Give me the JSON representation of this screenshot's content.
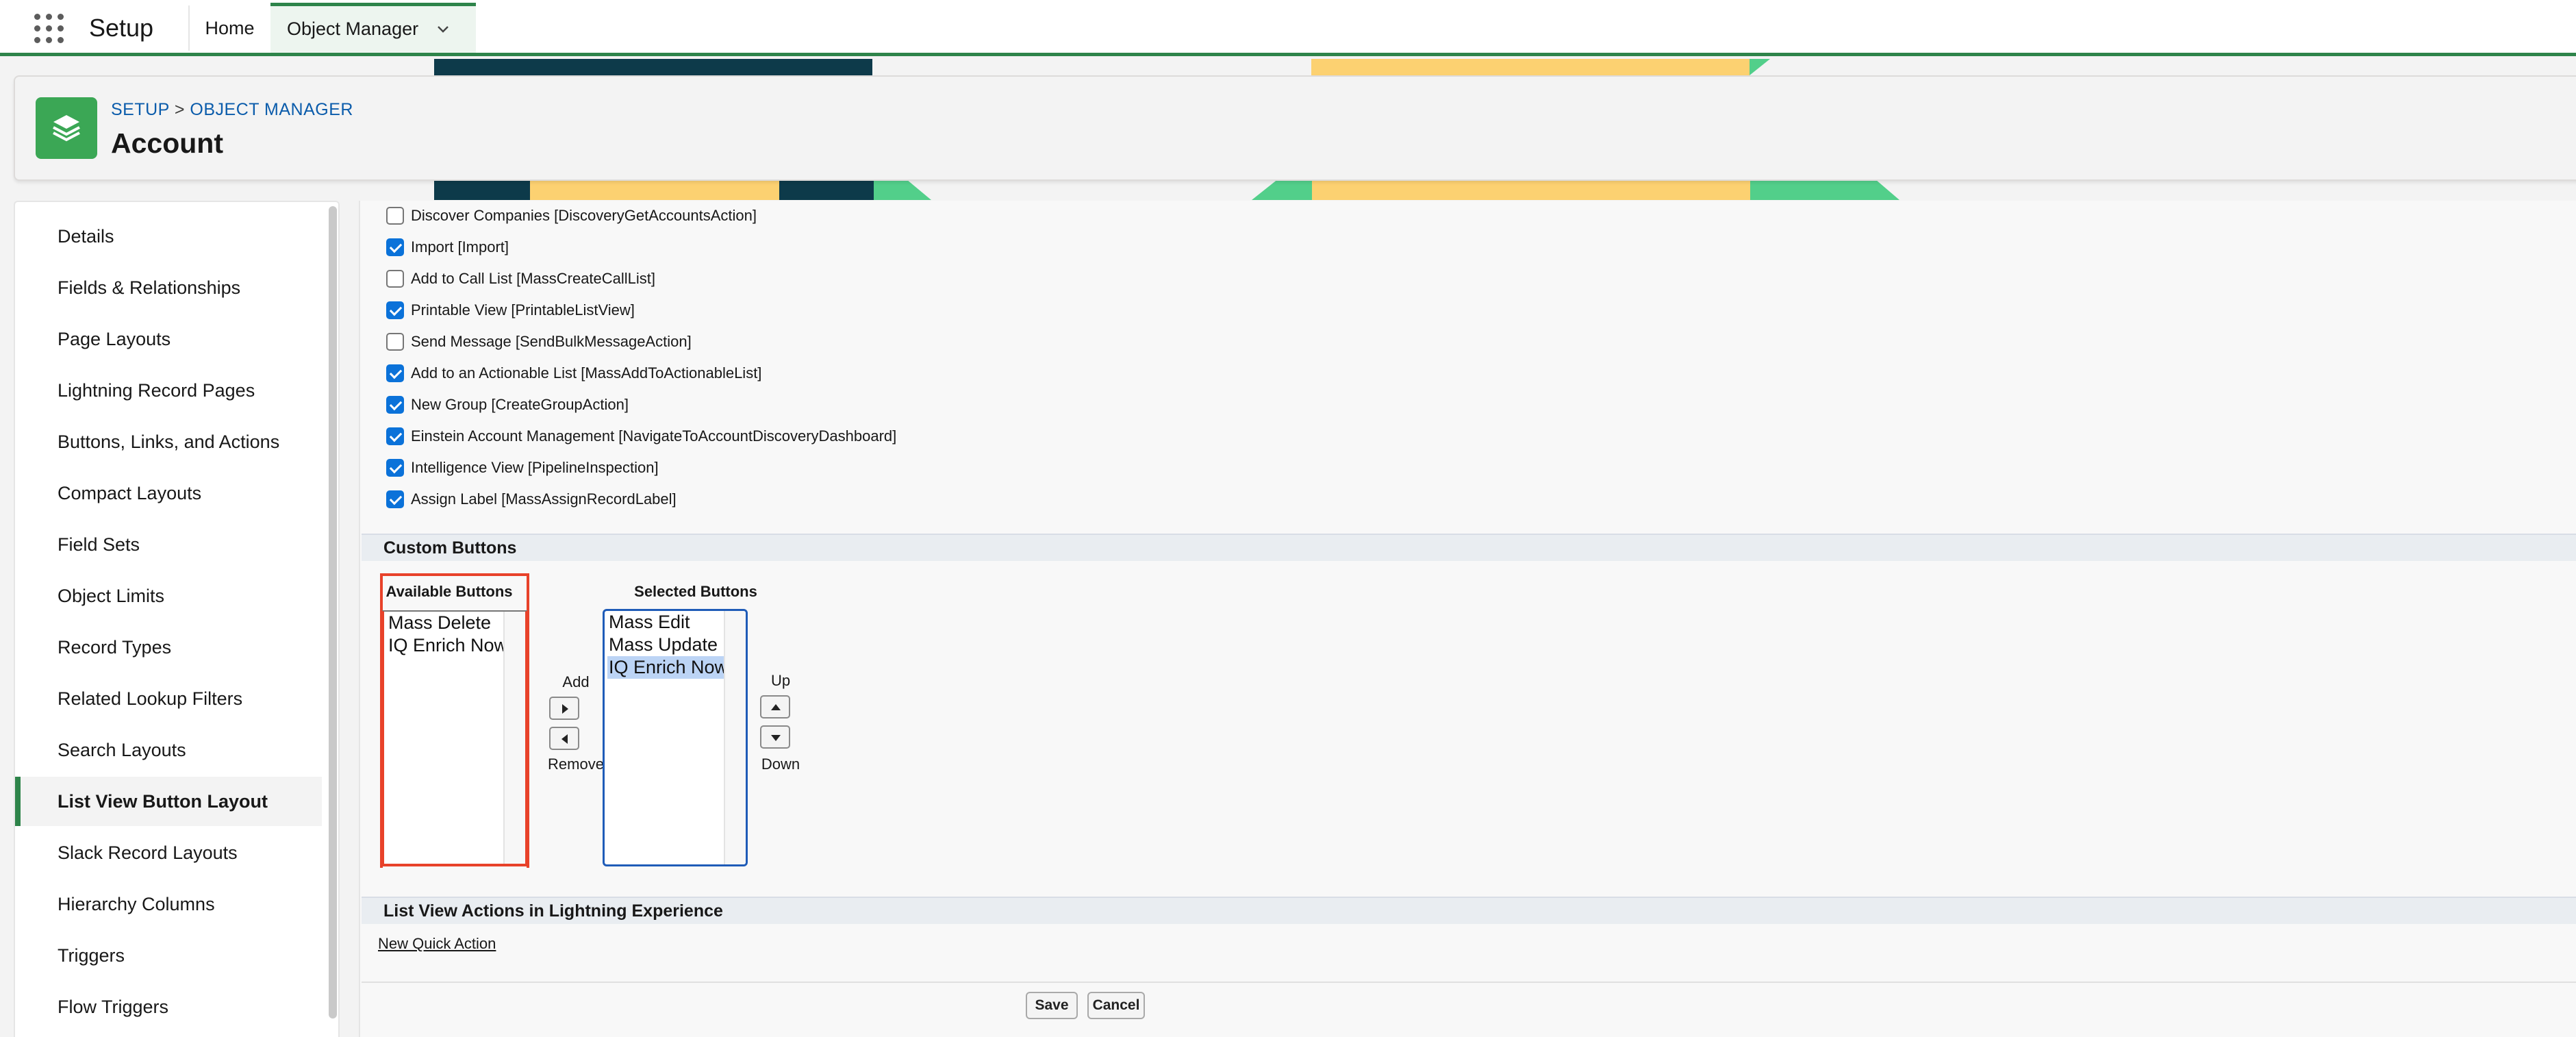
{
  "nav": {
    "app_name": "Setup",
    "tabs": [
      {
        "label": "Home"
      },
      {
        "label": "Object Manager"
      }
    ]
  },
  "header": {
    "breadcrumb_setup": "SETUP",
    "breadcrumb_sep": ">",
    "breadcrumb_object_manager": "OBJECT MANAGER",
    "title": "Account"
  },
  "sidebar": {
    "items": [
      {
        "label": "Details"
      },
      {
        "label": "Fields & Relationships"
      },
      {
        "label": "Page Layouts"
      },
      {
        "label": "Lightning Record Pages"
      },
      {
        "label": "Buttons, Links, and Actions"
      },
      {
        "label": "Compact Layouts"
      },
      {
        "label": "Field Sets"
      },
      {
        "label": "Object Limits"
      },
      {
        "label": "Record Types"
      },
      {
        "label": "Related Lookup Filters"
      },
      {
        "label": "Search Layouts"
      },
      {
        "label": "List View Button Layout"
      },
      {
        "label": "Slack Record Layouts"
      },
      {
        "label": "Hierarchy Columns"
      },
      {
        "label": "Triggers"
      },
      {
        "label": "Flow Triggers"
      }
    ],
    "active_index": 11
  },
  "standard_buttons": [
    {
      "label": "Discover Companies [DiscoveryGetAccountsAction]",
      "checked": false
    },
    {
      "label": "Import [Import]",
      "checked": true
    },
    {
      "label": "Add to Call List [MassCreateCallList]",
      "checked": false
    },
    {
      "label": "Printable View [PrintableListView]",
      "checked": true
    },
    {
      "label": "Send Message [SendBulkMessageAction]",
      "checked": false
    },
    {
      "label": "Add to an Actionable List [MassAddToActionableList]",
      "checked": true
    },
    {
      "label": "New Group [CreateGroupAction]",
      "checked": true
    },
    {
      "label": "Einstein Account Management [NavigateToAccountDiscoveryDashboard]",
      "checked": true
    },
    {
      "label": "Intelligence View [PipelineInspection]",
      "checked": true
    },
    {
      "label": "Assign Label [MassAssignRecordLabel]",
      "checked": true
    }
  ],
  "custom_buttons": {
    "section_title": "Custom Buttons",
    "available_label": "Available Buttons",
    "available": [
      "Mass Delete",
      "IQ Enrich Now"
    ],
    "selected_label": "Selected Buttons",
    "selected": [
      "Mass Edit",
      "Mass Update",
      "IQ Enrich Now"
    ],
    "selected_highlight_index": 2,
    "add_label": "Add",
    "remove_label": "Remove",
    "up_label": "Up",
    "down_label": "Down"
  },
  "lightning_actions": {
    "section_title": "List View Actions in Lightning Experience",
    "new_quick_action": "New Quick Action"
  },
  "footer": {
    "save_label": "Save",
    "cancel_label": "Cancel"
  },
  "colors": {
    "brand_green": "#2e844a",
    "object_icon": "#3ba755",
    "checkbox_blue": "#0b72d9",
    "highlight_red": "#e8422a",
    "selected_blue": "#1f5cb8",
    "banner_navy": "#0d3a4a",
    "banner_yellow": "#fcd171",
    "banner_green": "#52cf8a"
  },
  "icons": {
    "launcher": "waffle-icon",
    "tab_menu": "chevron-down-icon",
    "object": "layers-icon"
  }
}
